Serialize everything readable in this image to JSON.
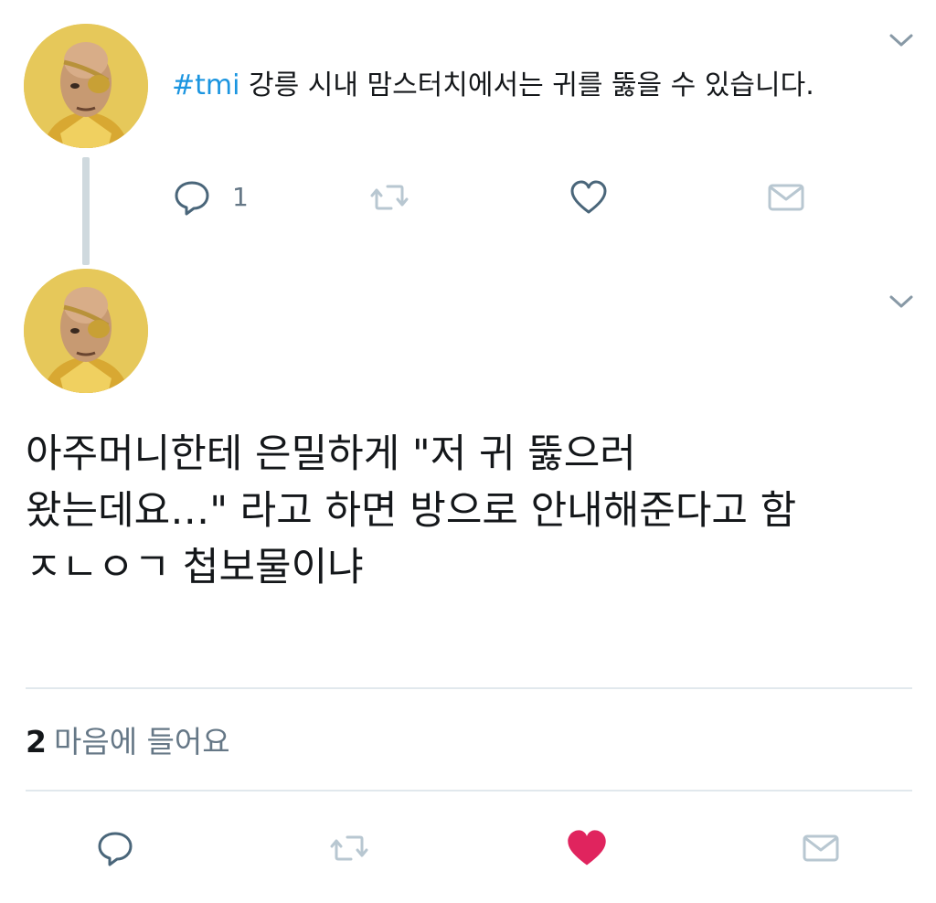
{
  "tweet1": {
    "hashtag": "#tmi",
    "text": " 강릉 시내 맘스터치에서는 귀를 뚫을 수 있습니다.",
    "reply_count": "1"
  },
  "tweet2": {
    "lines": [
      "아주머니한테 은밀하게 \"저 귀 뚫으러",
      "왔는데요…\" 라고 하면 방으로 안내해준다고 함",
      "ㅈㄴㅇㄱ 첩보물이냐"
    ],
    "likes_count": "2",
    "likes_label": "마음에 들어요"
  },
  "icons": {
    "reply": "reply-icon",
    "retweet": "retweet-icon",
    "like": "heart-icon",
    "message": "mail-icon",
    "more": "chevron-down-icon"
  },
  "colors": {
    "hashtag": "#1b95e0",
    "icon_gray": "#8899a6",
    "icon_blue_gray": "#4a667a",
    "like_active": "#e0245e",
    "divider": "#e1e8ed"
  }
}
